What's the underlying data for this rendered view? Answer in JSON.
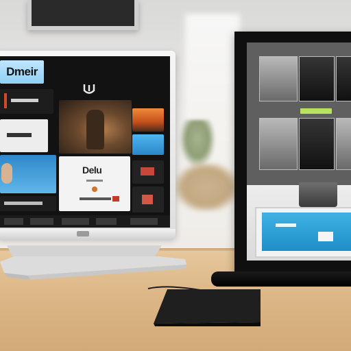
{
  "scene": {
    "description_type": "photo of a television and a monitor on a desk",
    "colors": {
      "wall": "#e7e6e2",
      "desk": "#dcb686",
      "left_tv_bezel": "#eeeeee",
      "right_monitor_frame": "#0f0f0f",
      "accent_blue": "#2f87c9",
      "accent_green": "#b6e35c",
      "accent_red": "#d24a2e"
    }
  },
  "left_tv": {
    "logo_text": "Dmeir",
    "home_icon": "U-shaped-icon",
    "feature_title": "Delu"
  },
  "right_monitor": {
    "thumbnail_count_top": 3,
    "thumbnail_count_mid": 3
  }
}
